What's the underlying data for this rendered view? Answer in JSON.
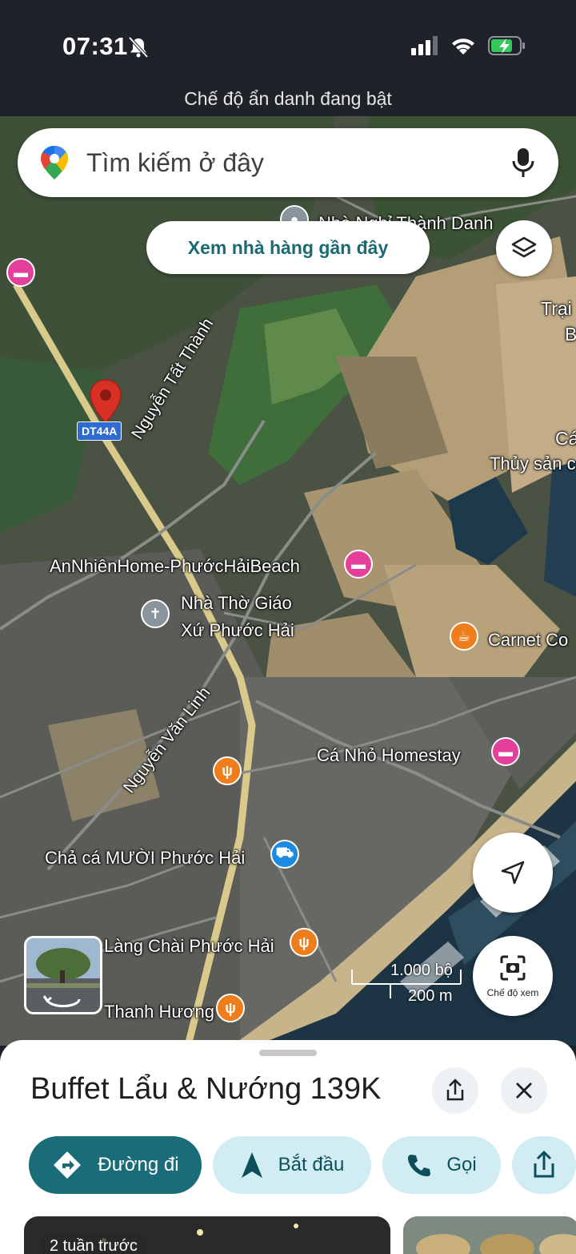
{
  "status": {
    "time": "07:31",
    "incognito_banner": "Chế độ ẩn danh đang bật"
  },
  "search": {
    "placeholder": "Tìm kiếm ở đây"
  },
  "chip": {
    "label": "Xem nhà hàng gần đây"
  },
  "road_shield": "DT44A",
  "map_labels": {
    "nha_nghi": "Nhà Nghỉ Thành Danh",
    "trai": "Trại",
    "b": "B",
    "ca": "Cá",
    "thuy_san": "Thủy sản c",
    "nguyen_tat_thanh": "Nguyễn Tất Thành",
    "an_nhien": "AnNhiênHome-PhướcHảiBeach",
    "nha_tho_1": "Nhà Thờ Giáo",
    "nha_tho_2": "Xứ Phước Hải",
    "carnet": "Carnet Co",
    "nguyen_van_linh": "Nguyễn Văn Linh",
    "ca_nho": "Cá Nhỏ Homestay",
    "cha_ca": "Chả cá MƯỜI Phước Hải",
    "lang_chai": "Làng Chài Phước Hải",
    "thanh_huong": "Thanh Hương"
  },
  "scale": {
    "feet": "1.000 bộ",
    "meters": "200 m"
  },
  "lens": {
    "label": "Chế độ xem"
  },
  "place": {
    "title": "Buffet Lẩu & Nướng 139K"
  },
  "actions": {
    "directions": "Đường đi",
    "start": "Bắt đầu",
    "call": "Gọi"
  },
  "photos": {
    "badge": "2 tuần trước"
  },
  "icons": [
    "bell-off-icon",
    "signal-icon",
    "wifi-icon",
    "battery-icon",
    "google-maps-logo-icon",
    "mic-icon",
    "layers-icon",
    "hotel-icon",
    "church-icon",
    "cafe-icon",
    "restaurant-icon",
    "shopping-cart-icon",
    "location-pin-icon",
    "navigate-arrow-icon",
    "lens-camera-icon",
    "street-view-icon",
    "share-icon",
    "close-icon",
    "directions-icon",
    "start-navigation-icon",
    "phone-icon"
  ],
  "colors": {
    "primary": "#1a6d78",
    "secondary_bg": "#d2ecf3",
    "pink_poi": "#e43f9b",
    "orange_poi": "#f07d1b",
    "pin": "#d93025"
  }
}
